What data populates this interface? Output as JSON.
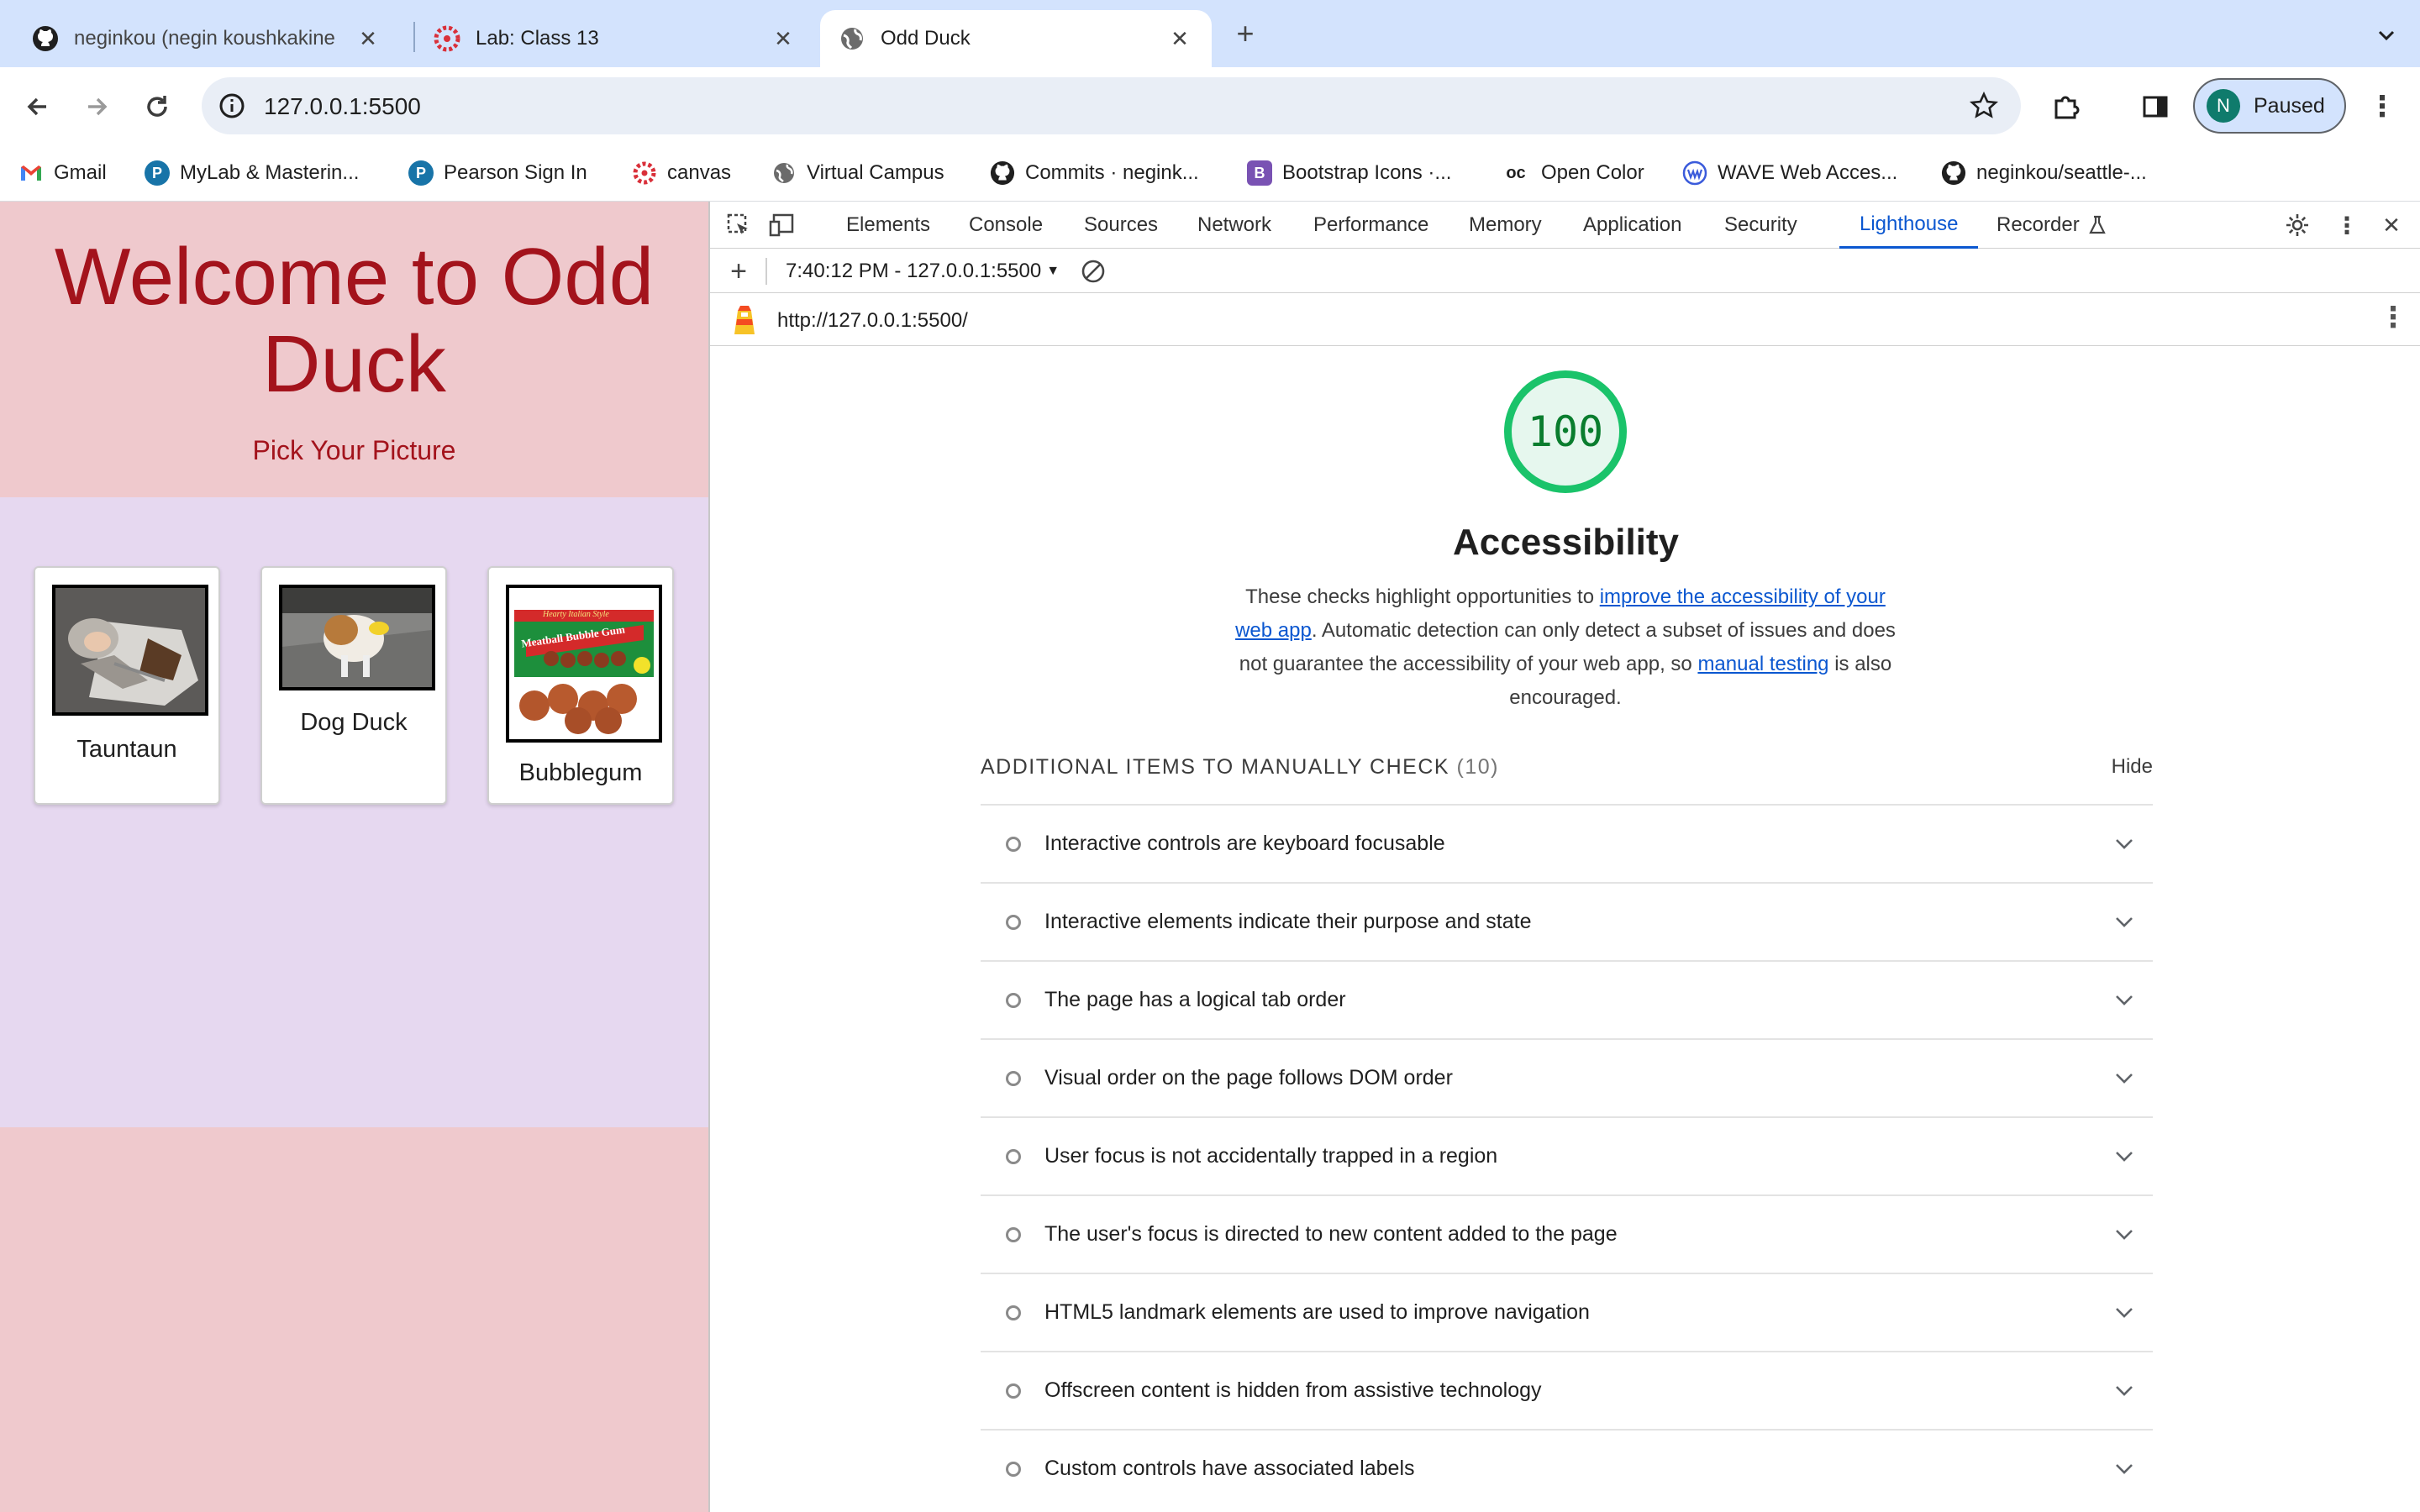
{
  "browser": {
    "tabs": [
      {
        "title": "neginkou (negin koushkakine",
        "icon": "github-icon",
        "active": false
      },
      {
        "title": "Lab: Class 13",
        "icon": "canvas-icon",
        "active": false
      },
      {
        "title": "Odd Duck",
        "icon": "globe-icon",
        "active": true
      }
    ],
    "new_tab_label": "+",
    "tab_search_icon": "chevron-down-icon",
    "address": "127.0.0.1:5500",
    "profile": {
      "initial": "N",
      "label": "Paused",
      "avatar_color": "#0f7b6c"
    },
    "bookmarks": [
      {
        "label": "Gmail",
        "icon": "gmail-icon"
      },
      {
        "label": "MyLab & Masterin...",
        "icon": "pearson-icon"
      },
      {
        "label": "Pearson Sign In",
        "icon": "pearson-icon"
      },
      {
        "label": "canvas",
        "icon": "canvas-icon"
      },
      {
        "label": "Virtual Campus",
        "icon": "globe-icon"
      },
      {
        "label": "Commits · negink...",
        "icon": "github-icon"
      },
      {
        "label": "Bootstrap Icons ·...",
        "icon": "bootstrap-icon"
      },
      {
        "label": "Open Color",
        "icon": "open-color-icon"
      },
      {
        "label": "WAVE Web Acces...",
        "icon": "wave-icon"
      },
      {
        "label": "neginkou/seattle-...",
        "icon": "github-icon"
      }
    ]
  },
  "page": {
    "title": "Welcome to Odd Duck",
    "subtitle": "Pick Your Picture",
    "products": [
      {
        "name": "Tauntaun"
      },
      {
        "name": "Dog Duck"
      },
      {
        "name": "Bubblegum"
      }
    ],
    "bubblegum_package": {
      "line1": "Hearty Italian Style",
      "line2": "Meatball Bubble Gum"
    },
    "colors": {
      "header_bg": "#efc9cd",
      "main_bg": "#e6d8f0",
      "title_color": "#a3131c"
    }
  },
  "devtools": {
    "tabs": [
      "Elements",
      "Console",
      "Sources",
      "Network",
      "Performance",
      "Memory",
      "Application",
      "Security",
      "Lighthouse",
      "Recorder"
    ],
    "active_tab": "Lighthouse",
    "report_selector": "7:40:12 PM - 127.0.0.1:5500",
    "report_url": "http://127.0.0.1:5500/",
    "score": "100",
    "category": "Accessibility",
    "description": {
      "p1": "These checks highlight opportunities to ",
      "link1": "improve the accessibility of your web app",
      "p2": ". Automatic detection can only detect a subset of issues and does not guarantee the accessibility of your web app, so ",
      "link2": "manual testing",
      "p3": " is also encouraged."
    },
    "manual_check": {
      "title": "ADDITIONAL ITEMS TO MANUALLY CHECK",
      "count": "(10)",
      "hide_label": "Hide",
      "items": [
        "Interactive controls are keyboard focusable",
        "Interactive elements indicate their purpose and state",
        "The page has a logical tab order",
        "Visual order on the page follows DOM order",
        "User focus is not accidentally trapped in a region",
        "The user's focus is directed to new content added to the page",
        "HTML5 landmark elements are used to improve navigation",
        "Offscreen content is hidden from assistive technology",
        "Custom controls have associated labels"
      ]
    },
    "accent_color": "#0b57d0",
    "score_color": "#1ac36a"
  }
}
